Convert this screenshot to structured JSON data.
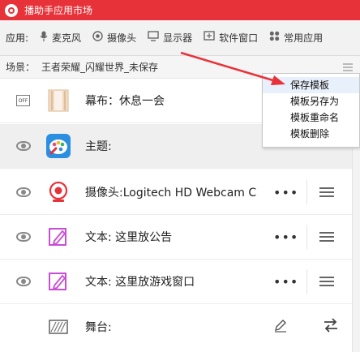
{
  "titlebar": {
    "title": "播助手应用市场"
  },
  "appbar": {
    "label": "应用:",
    "apps": [
      {
        "icon": "microphone-icon",
        "label": "麦克风"
      },
      {
        "icon": "camera-icon",
        "label": "摄像头"
      },
      {
        "icon": "monitor-icon",
        "label": "显示器"
      },
      {
        "icon": "window-icon",
        "label": "软件窗口"
      },
      {
        "icon": "apps-grid-icon",
        "label": "常用应用"
      }
    ]
  },
  "scene": {
    "label": "场景：",
    "name": "王者荣耀_闪耀世界_未保存"
  },
  "context_menu": {
    "items": [
      "保存模板",
      "模板另存为",
      "模板重命名",
      "模板删除"
    ]
  },
  "sources": [
    {
      "visibility_icon": "off-badge-icon",
      "off_text": "OFF",
      "source_icon": "curtain-icon",
      "label": "幕布：休息一会",
      "selected": false
    },
    {
      "visibility_icon": "eye-icon",
      "source_icon": "theme-palette-icon",
      "label": "主题:",
      "selected": true
    },
    {
      "visibility_icon": "eye-icon",
      "source_icon": "webcam-icon",
      "label": "摄像头:Logitech HD Webcam C",
      "selected": false
    },
    {
      "visibility_icon": "eye-icon",
      "source_icon": "text-edit-icon",
      "label": "文本: 这里放公告",
      "selected": false
    },
    {
      "visibility_icon": "eye-icon",
      "source_icon": "text-edit-icon",
      "label": "文本: 这里放游戏窗口",
      "selected": false
    },
    {
      "source_icon": "stage-icon",
      "label": "舞台:",
      "selected": false
    }
  ],
  "colors": {
    "brand_red": "#e8323a",
    "accent_blue": "#2f6fd9",
    "pink": "#e94c8a"
  }
}
